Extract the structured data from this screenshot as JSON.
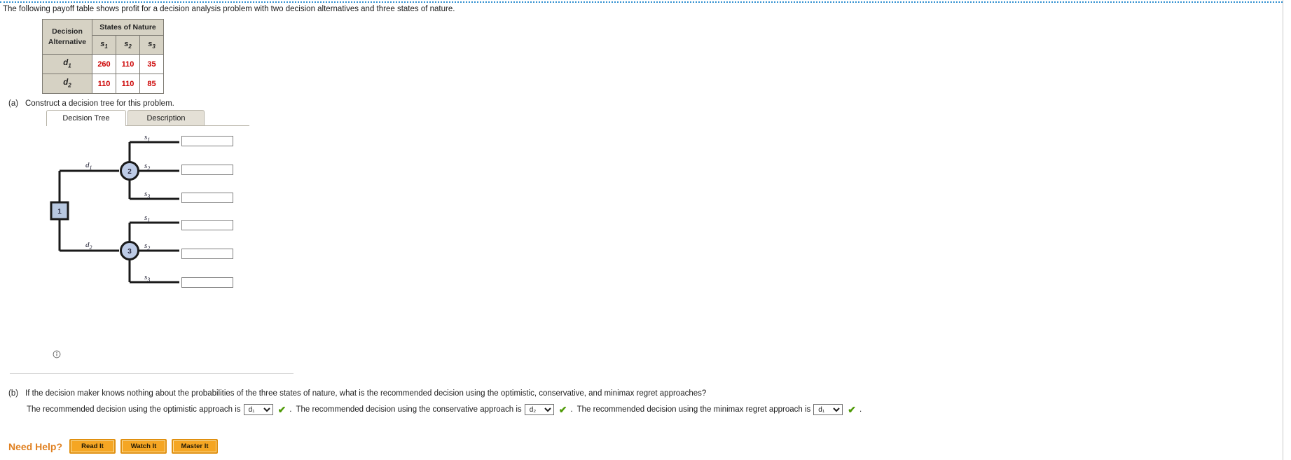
{
  "intro": {
    "text": "The following payoff table shows profit for a decision analysis problem with two decision alternatives and three states of nature."
  },
  "payoff_table": {
    "corner_line1": "Decision",
    "corner_line2": "Alternative",
    "states_header": "States of Nature",
    "state_columns": [
      {
        "base": "s",
        "sub": "1"
      },
      {
        "base": "s",
        "sub": "2"
      },
      {
        "base": "s",
        "sub": "3"
      }
    ],
    "rows": [
      {
        "label_base": "d",
        "label_sub": "1",
        "values": [
          "260",
          "110",
          "35"
        ]
      },
      {
        "label_base": "d",
        "label_sub": "2",
        "values": [
          "110",
          "110",
          "85"
        ]
      }
    ],
    "value_color": "#cc0000",
    "header_bg": "#d6d2c4"
  },
  "part_a": {
    "label": "(a)",
    "prompt": "Construct a decision tree for this problem.",
    "tabs": [
      {
        "label": "Decision Tree",
        "active": true
      },
      {
        "label": "Description",
        "active": false
      }
    ],
    "info_icon": "info-circle-icon"
  },
  "decision_tree": {
    "node_decision": {
      "id": "1",
      "shape": "square",
      "fill": "#b8c8e0"
    },
    "node_chance_top": {
      "id": "2",
      "shape": "circle",
      "fill": "#bdcbe6"
    },
    "node_chance_bottom": {
      "id": "3",
      "shape": "circle",
      "fill": "#bdcbe6"
    },
    "branch_d1": {
      "base": "d",
      "sub": "1"
    },
    "branch_d2": {
      "base": "d",
      "sub": "2"
    },
    "state_branches_top": [
      {
        "base": "s",
        "sub": "1"
      },
      {
        "base": "s",
        "sub": "2"
      },
      {
        "base": "s",
        "sub": "3"
      }
    ],
    "state_branches_bottom": [
      {
        "base": "s",
        "sub": "1"
      },
      {
        "base": "s",
        "sub": "2"
      },
      {
        "base": "s",
        "sub": "3"
      }
    ],
    "payoff_inputs": [
      "",
      "",
      "",
      "",
      "",
      ""
    ]
  },
  "part_b": {
    "label": "(b)",
    "prompt": "If the decision maker knows nothing about the probabilities of the three states of nature, what is the recommended decision using the optimistic, conservative, and minimax regret approaches?",
    "answers": [
      {
        "lead": "The recommended decision using the optimistic approach is",
        "selected": "d₁",
        "options": [
          "d₁",
          "d₂"
        ],
        "status": "correct",
        "trailing": "."
      },
      {
        "lead": "The recommended decision using the conservative approach is",
        "selected": "d₂",
        "options": [
          "d₁",
          "d₂"
        ],
        "status": "correct",
        "trailing": "."
      },
      {
        "lead": "The recommended decision using the minimax regret approach is",
        "selected": "d₁",
        "options": [
          "d₁",
          "d₂"
        ],
        "status": "correct",
        "trailing": "."
      }
    ],
    "check_glyph": "✔"
  },
  "need_help": {
    "label": "Need Help?",
    "buttons": [
      "Read It",
      "Watch It",
      "Master It"
    ],
    "accent_color": "#f5a623"
  }
}
